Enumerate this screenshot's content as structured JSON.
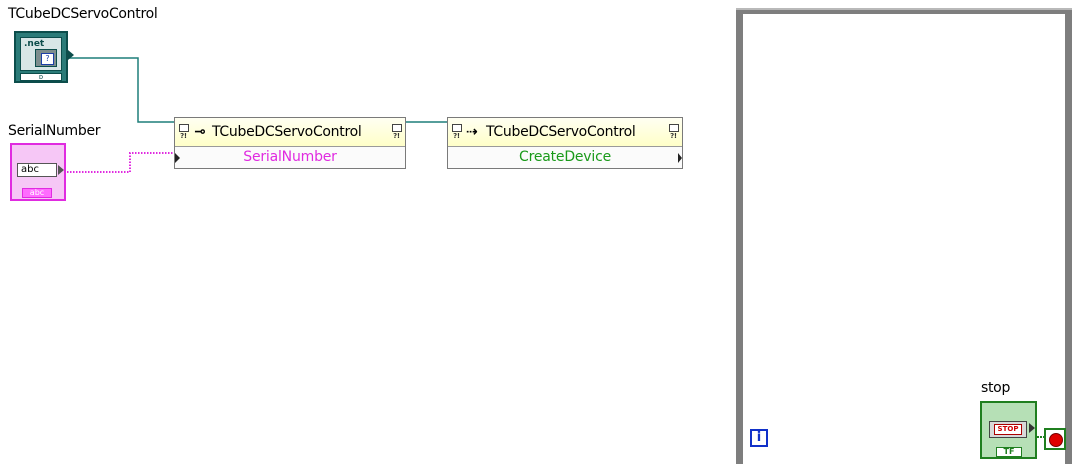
{
  "labels": {
    "net_control": "TCubeDCServoControl",
    "serial_control": "SerialNumber",
    "stop_control": "stop"
  },
  "net_refnum": {
    "badge": ".net",
    "icon_glyph": "?",
    "foot_glyph": "ᴅ"
  },
  "string_control": {
    "value": "abc",
    "type_badge": "abc"
  },
  "property_node": {
    "class_name": "TCubeDCServoControl",
    "property": "SerialNumber",
    "icon": "property-node-icon"
  },
  "invoke_node": {
    "class_name": "TCubeDCServoControl",
    "method": "CreateDevice",
    "icon": "invoke-node-icon"
  },
  "while_loop": {
    "iteration_glyph": "i",
    "stop_button_text": "STOP",
    "bool_badge": "TF"
  },
  "colors": {
    "refnum_wire": "#1f7f7a",
    "string_wire": "#e02be0",
    "property_text": "#e02be0",
    "method_text": "#1a9a1a",
    "loop_border": "#7e7e7e",
    "boolean": "#1f7f1f",
    "iteration": "#1131c9"
  }
}
